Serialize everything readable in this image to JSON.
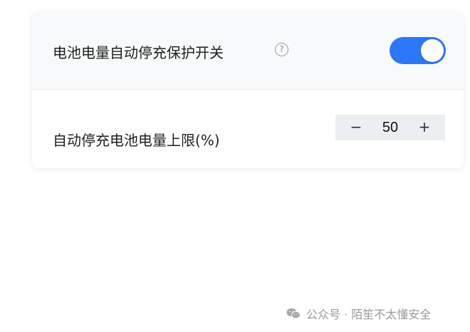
{
  "settings": {
    "battery_protection": {
      "label": "电池电量自动停充保护开关",
      "help_glyph": "?",
      "enabled": true,
      "accent_color": "#2b77f5"
    },
    "charge_limit": {
      "label": "自动停充电池电量上限(%)",
      "minus_glyph": "−",
      "value": "50",
      "plus_glyph": "+"
    }
  },
  "watermark": {
    "icon": "wechat-icon",
    "text": "公众号 · 陌笙不太懂安全"
  }
}
